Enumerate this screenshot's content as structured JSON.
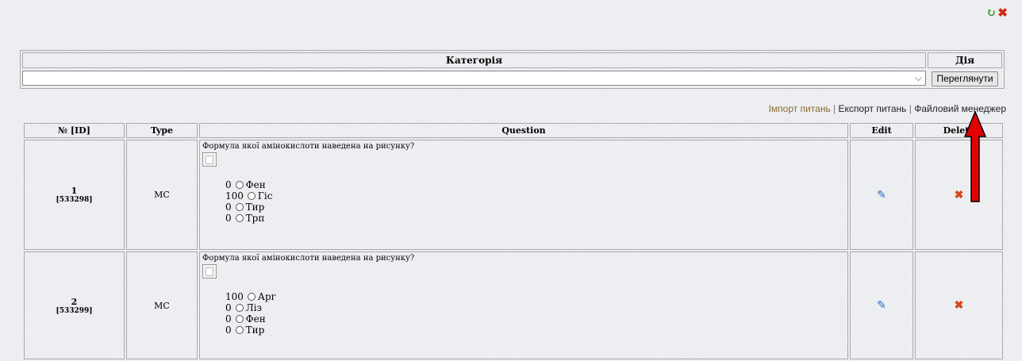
{
  "top_icons": {
    "back": "↻",
    "exit": "✖"
  },
  "category_table": {
    "header_category": "Категорія",
    "header_action": "Дія",
    "select_value": "",
    "view_button": "Переглянути"
  },
  "links": {
    "import": "Імпорт питань",
    "sep1": " | ",
    "export": "Експорт питань",
    "sep2": " | ",
    "file_manager": "Файловий менеджер"
  },
  "questions_table": {
    "headers": [
      "№ [ID]",
      "Type",
      "Question",
      "Edit",
      "Delete"
    ],
    "rows": [
      {
        "num": "1",
        "id": "[533298]",
        "type": "MC",
        "question": "Формула якої амінокислоти наведена на рисунку?",
        "answers": [
          {
            "score": "0",
            "label": "Фен"
          },
          {
            "score": "100",
            "label": "Гіс"
          },
          {
            "score": "0",
            "label": "Тир"
          },
          {
            "score": "0",
            "label": "Трп"
          }
        ]
      },
      {
        "num": "2",
        "id": "[533299]",
        "type": "MC",
        "question": "Формула якої амінокислоти наведена на рисунку?",
        "answers": [
          {
            "score": "100",
            "label": "Арг"
          },
          {
            "score": "0",
            "label": "Ліз"
          },
          {
            "score": "0",
            "label": "Фен"
          },
          {
            "score": "0",
            "label": "Тир"
          }
        ]
      }
    ]
  },
  "icons": {
    "edit": "pencil-icon",
    "delete": "red-x-icon"
  },
  "colors": {
    "arrow": "#e30000",
    "delete_icon": "#d8481a",
    "edit_icon": "#2e6dc4",
    "import_link": "#8b6a2b"
  }
}
